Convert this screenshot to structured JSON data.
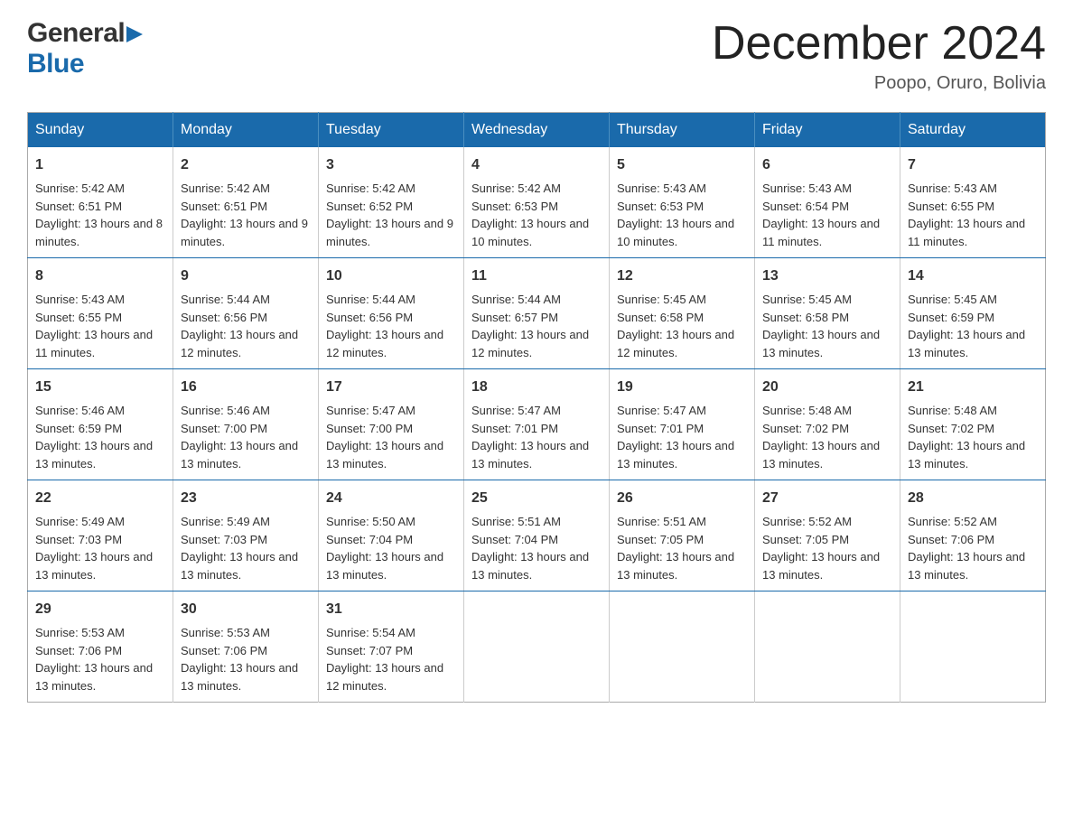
{
  "header": {
    "logo_general": "General",
    "logo_blue": "Blue",
    "month_title": "December 2024",
    "location": "Poopo, Oruro, Bolivia"
  },
  "weekdays": [
    "Sunday",
    "Monday",
    "Tuesday",
    "Wednesday",
    "Thursday",
    "Friday",
    "Saturday"
  ],
  "weeks": [
    [
      {
        "day": "1",
        "sunrise": "5:42 AM",
        "sunset": "6:51 PM",
        "daylight": "13 hours and 8 minutes."
      },
      {
        "day": "2",
        "sunrise": "5:42 AM",
        "sunset": "6:51 PM",
        "daylight": "13 hours and 9 minutes."
      },
      {
        "day": "3",
        "sunrise": "5:42 AM",
        "sunset": "6:52 PM",
        "daylight": "13 hours and 9 minutes."
      },
      {
        "day": "4",
        "sunrise": "5:42 AM",
        "sunset": "6:53 PM",
        "daylight": "13 hours and 10 minutes."
      },
      {
        "day": "5",
        "sunrise": "5:43 AM",
        "sunset": "6:53 PM",
        "daylight": "13 hours and 10 minutes."
      },
      {
        "day": "6",
        "sunrise": "5:43 AM",
        "sunset": "6:54 PM",
        "daylight": "13 hours and 11 minutes."
      },
      {
        "day": "7",
        "sunrise": "5:43 AM",
        "sunset": "6:55 PM",
        "daylight": "13 hours and 11 minutes."
      }
    ],
    [
      {
        "day": "8",
        "sunrise": "5:43 AM",
        "sunset": "6:55 PM",
        "daylight": "13 hours and 11 minutes."
      },
      {
        "day": "9",
        "sunrise": "5:44 AM",
        "sunset": "6:56 PM",
        "daylight": "13 hours and 12 minutes."
      },
      {
        "day": "10",
        "sunrise": "5:44 AM",
        "sunset": "6:56 PM",
        "daylight": "13 hours and 12 minutes."
      },
      {
        "day": "11",
        "sunrise": "5:44 AM",
        "sunset": "6:57 PM",
        "daylight": "13 hours and 12 minutes."
      },
      {
        "day": "12",
        "sunrise": "5:45 AM",
        "sunset": "6:58 PM",
        "daylight": "13 hours and 12 minutes."
      },
      {
        "day": "13",
        "sunrise": "5:45 AM",
        "sunset": "6:58 PM",
        "daylight": "13 hours and 13 minutes."
      },
      {
        "day": "14",
        "sunrise": "5:45 AM",
        "sunset": "6:59 PM",
        "daylight": "13 hours and 13 minutes."
      }
    ],
    [
      {
        "day": "15",
        "sunrise": "5:46 AM",
        "sunset": "6:59 PM",
        "daylight": "13 hours and 13 minutes."
      },
      {
        "day": "16",
        "sunrise": "5:46 AM",
        "sunset": "7:00 PM",
        "daylight": "13 hours and 13 minutes."
      },
      {
        "day": "17",
        "sunrise": "5:47 AM",
        "sunset": "7:00 PM",
        "daylight": "13 hours and 13 minutes."
      },
      {
        "day": "18",
        "sunrise": "5:47 AM",
        "sunset": "7:01 PM",
        "daylight": "13 hours and 13 minutes."
      },
      {
        "day": "19",
        "sunrise": "5:47 AM",
        "sunset": "7:01 PM",
        "daylight": "13 hours and 13 minutes."
      },
      {
        "day": "20",
        "sunrise": "5:48 AM",
        "sunset": "7:02 PM",
        "daylight": "13 hours and 13 minutes."
      },
      {
        "day": "21",
        "sunrise": "5:48 AM",
        "sunset": "7:02 PM",
        "daylight": "13 hours and 13 minutes."
      }
    ],
    [
      {
        "day": "22",
        "sunrise": "5:49 AM",
        "sunset": "7:03 PM",
        "daylight": "13 hours and 13 minutes."
      },
      {
        "day": "23",
        "sunrise": "5:49 AM",
        "sunset": "7:03 PM",
        "daylight": "13 hours and 13 minutes."
      },
      {
        "day": "24",
        "sunrise": "5:50 AM",
        "sunset": "7:04 PM",
        "daylight": "13 hours and 13 minutes."
      },
      {
        "day": "25",
        "sunrise": "5:51 AM",
        "sunset": "7:04 PM",
        "daylight": "13 hours and 13 minutes."
      },
      {
        "day": "26",
        "sunrise": "5:51 AM",
        "sunset": "7:05 PM",
        "daylight": "13 hours and 13 minutes."
      },
      {
        "day": "27",
        "sunrise": "5:52 AM",
        "sunset": "7:05 PM",
        "daylight": "13 hours and 13 minutes."
      },
      {
        "day": "28",
        "sunrise": "5:52 AM",
        "sunset": "7:06 PM",
        "daylight": "13 hours and 13 minutes."
      }
    ],
    [
      {
        "day": "29",
        "sunrise": "5:53 AM",
        "sunset": "7:06 PM",
        "daylight": "13 hours and 13 minutes."
      },
      {
        "day": "30",
        "sunrise": "5:53 AM",
        "sunset": "7:06 PM",
        "daylight": "13 hours and 13 minutes."
      },
      {
        "day": "31",
        "sunrise": "5:54 AM",
        "sunset": "7:07 PM",
        "daylight": "13 hours and 12 minutes."
      },
      null,
      null,
      null,
      null
    ]
  ]
}
